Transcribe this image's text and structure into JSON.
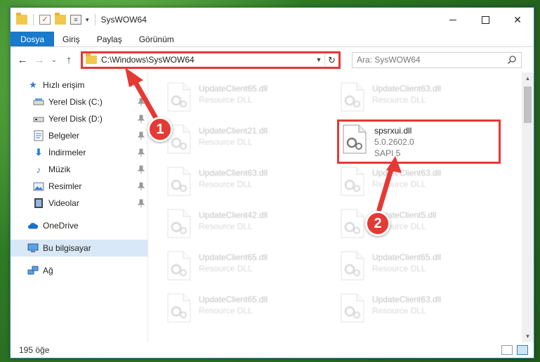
{
  "window": {
    "title": "SysWOW64",
    "minimize_label": "",
    "close_label": "✕"
  },
  "ribbon": {
    "tabs": [
      "Dosya",
      "Giriş",
      "Paylaş",
      "Görünüm"
    ]
  },
  "navigation": {
    "back": "←",
    "forward": "→",
    "recent": "⌄",
    "up": "↑",
    "address": "C:\\Windows\\SysWOW64",
    "refresh": "↻"
  },
  "search": {
    "placeholder": "Ara: SysWOW64"
  },
  "sidebar": {
    "quick_access": "Hızlı erişim",
    "items": [
      {
        "label": "Yerel Disk (C:)",
        "icon": "drive-icon",
        "pinned": true
      },
      {
        "label": "Yerel Disk (D:)",
        "icon": "drive-icon",
        "pinned": true
      },
      {
        "label": "Belgeler",
        "icon": "documents-icon",
        "pinned": true
      },
      {
        "label": "İndirmeler",
        "icon": "download-icon",
        "pinned": true
      },
      {
        "label": "Müzik",
        "icon": "music-icon",
        "pinned": true
      },
      {
        "label": "Resimler",
        "icon": "pictures-icon",
        "pinned": true
      },
      {
        "label": "Videolar",
        "icon": "video-icon",
        "pinned": true
      }
    ],
    "onedrive": "OneDrive",
    "this_pc": "Bu bilgisayar",
    "network": "Ağ"
  },
  "files": [
    {
      "name": "UpdateClient65.dll",
      "sub": "Resource DLL",
      "faded": true
    },
    {
      "name": "UpdateClient63.dll",
      "sub": "Resource DLL",
      "faded": true
    },
    {
      "name": "UpdateClient21.dll",
      "sub": "Resource DLL",
      "faded": true
    },
    {
      "name": "spsrxui.dll",
      "sub": "5.0.2602.0",
      "sub2": "SAPI 5",
      "faded": false,
      "highlight": true
    },
    {
      "name": "UpdateClient63.dll",
      "sub": "Resource DLL",
      "faded": true
    },
    {
      "name": "UpdateClient63.dll",
      "sub": "Resource DLL",
      "faded": true
    },
    {
      "name": "UpdateClient42.dll",
      "sub": "Resource DLL",
      "faded": true
    },
    {
      "name": "UpdateClient5.dll",
      "sub": "Resource DLL",
      "faded": true
    },
    {
      "name": "UpdateClient65.dll",
      "sub": "Resource DLL",
      "faded": true
    },
    {
      "name": "UpdateClient65.dll",
      "sub": "Resource DLL",
      "faded": true
    },
    {
      "name": "UpdateClient65.dll",
      "sub": "Resource DLL",
      "faded": true
    },
    {
      "name": "UpdateClient63.dll",
      "sub": "Resource DLL",
      "faded": true
    }
  ],
  "status": {
    "count": "195 öğe"
  },
  "annotations": {
    "step1": "1",
    "step2": "2",
    "color": "#e53935"
  }
}
